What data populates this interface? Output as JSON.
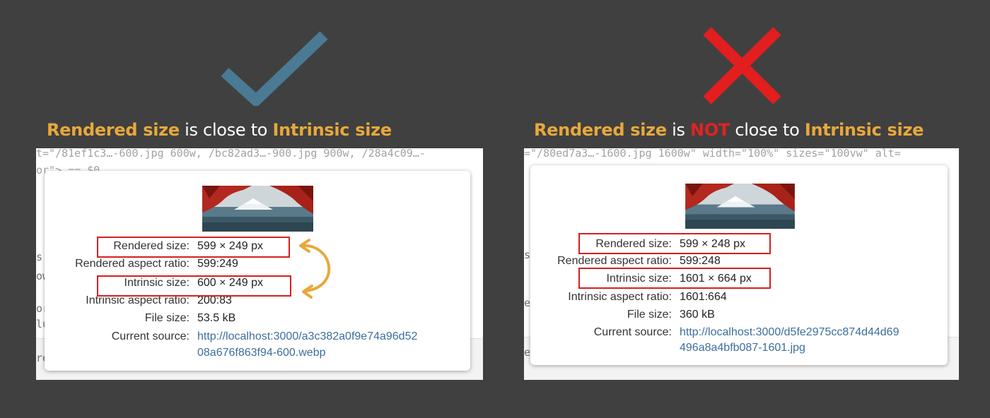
{
  "colors": {
    "background": "#404040",
    "highlight": "#e8a83b",
    "error": "#e12323",
    "check": "#4a7a94",
    "cross": "#e21e1e",
    "link": "#3d6e9c",
    "box": "#d81e1e"
  },
  "left": {
    "icon": "checkmark-icon",
    "headline": {
      "part1": "Rendered size",
      "part2": " is close to ",
      "part3": "Intrinsic size"
    },
    "code_top": "t=\"/81ef1c3…-600.jpg 600w, /bc82ad3…-900.jpg 900w, /28a4c09…-",
    "code_second": "or\"> == $0",
    "gutter": [
      "s",
      "ow",
      "or",
      "lu",
      "re"
    ],
    "tooltip": {
      "rows": [
        {
          "key": "Rendered size:",
          "value": "599 × 249 px"
        },
        {
          "key": "Rendered aspect ratio:",
          "value": "599:249"
        },
        {
          "key": "Intrinsic size:",
          "value": "600 × 249 px"
        },
        {
          "key": "Intrinsic aspect ratio:",
          "value": "200:83"
        },
        {
          "key": "File size:",
          "value": "53.5 kB"
        },
        {
          "key": "Current source:",
          "value": "http://localhost:3000/a3c382a0f9e74a96d52",
          "value2": "08a676f863f94-600.webp"
        }
      ]
    }
  },
  "right": {
    "icon": "cross-icon",
    "headline": {
      "part1": "Rendered size",
      "part2": " is ",
      "part3": "NOT",
      "part4": " close to ",
      "part5": "Intrinsic size"
    },
    "code_top": "=\"/80ed7a3…-1600.jpg 1600w\" width=\"100%\" sizes=\"100vw\" alt=",
    "gutter": [
      "s",
      "e",
      "e"
    ],
    "tooltip": {
      "rows": [
        {
          "key": "Rendered size:",
          "value": "599 × 248 px"
        },
        {
          "key": "Rendered aspect ratio:",
          "value": "599:248"
        },
        {
          "key": "Intrinsic size:",
          "value": "1601 × 664 px"
        },
        {
          "key": "Intrinsic aspect ratio:",
          "value": "1601:664"
        },
        {
          "key": "File size:",
          "value": "360 kB"
        },
        {
          "key": "Current source:",
          "value": "http://localhost:3000/d5fe2975cc874d44d69",
          "value2": "496a8a4bfb087-1601.jpg"
        }
      ]
    }
  }
}
